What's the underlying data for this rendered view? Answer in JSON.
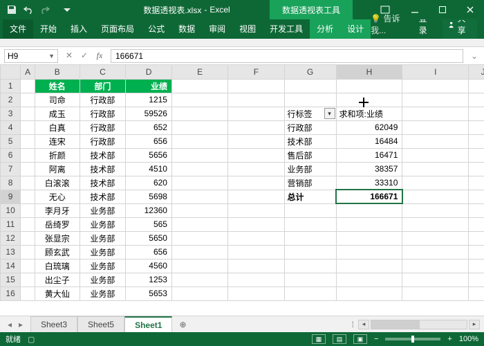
{
  "app": {
    "filename": "数据透视表.xlsx",
    "appname": "Excel",
    "context_tool": "数据透视表工具"
  },
  "ribbon": {
    "tabs": [
      "文件",
      "开始",
      "插入",
      "页面布局",
      "公式",
      "数据",
      "审阅",
      "视图",
      "开发工具",
      "分析",
      "设计"
    ],
    "tell_me": "告诉我...",
    "login": "登录",
    "share": "共享"
  },
  "namebox": {
    "ref": "H9",
    "formula": "166671"
  },
  "columns": [
    "",
    "A",
    "B",
    "C",
    "D",
    "E",
    "F",
    "G",
    "H",
    "I",
    "J"
  ],
  "data_rows": [
    {
      "r": "1",
      "b": "姓名",
      "c": "部门",
      "d": "业绩",
      "hdr": true
    },
    {
      "r": "2",
      "b": "司命",
      "c": "行政部",
      "d": "1215"
    },
    {
      "r": "3",
      "b": "成玉",
      "c": "行政部",
      "d": "59526",
      "g": "行标签",
      "h": "求和项:业绩",
      "pvt_hdr": true
    },
    {
      "r": "4",
      "b": "白真",
      "c": "行政部",
      "d": "652",
      "g": "行政部",
      "h": "62049"
    },
    {
      "r": "5",
      "b": "连宋",
      "c": "行政部",
      "d": "656",
      "g": "技术部",
      "h": "16484"
    },
    {
      "r": "6",
      "b": "折颜",
      "c": "技术部",
      "d": "5656",
      "g": "售后部",
      "h": "16471"
    },
    {
      "r": "7",
      "b": "阿离",
      "c": "技术部",
      "d": "4510",
      "g": "业务部",
      "h": "38357"
    },
    {
      "r": "8",
      "b": "白滚滚",
      "c": "技术部",
      "d": "620",
      "g": "营销部",
      "h": "33310"
    },
    {
      "r": "9",
      "b": "无心",
      "c": "技术部",
      "d": "5698",
      "g": "总计",
      "h": "166671",
      "total": true,
      "active": true
    },
    {
      "r": "10",
      "b": "李月牙",
      "c": "业务部",
      "d": "12360"
    },
    {
      "r": "11",
      "b": "岳绮罗",
      "c": "业务部",
      "d": "565"
    },
    {
      "r": "12",
      "b": "张显宗",
      "c": "业务部",
      "d": "5650"
    },
    {
      "r": "13",
      "b": "顾玄武",
      "c": "业务部",
      "d": "656"
    },
    {
      "r": "14",
      "b": "白琉璃",
      "c": "业务部",
      "d": "4560"
    },
    {
      "r": "15",
      "b": "出尘子",
      "c": "业务部",
      "d": "1253"
    },
    {
      "r": "16",
      "b": "黄大仙",
      "c": "业务部",
      "d": "5653"
    }
  ],
  "sheets": [
    "Sheet3",
    "Sheet5",
    "Sheet1"
  ],
  "active_sheet": "Sheet1",
  "status": {
    "ready": "就绪",
    "zoom": "100%"
  },
  "colwidths": {
    "rh": 28,
    "A": 20,
    "B": 62,
    "C": 64,
    "D": 64,
    "E": 78,
    "F": 78,
    "G": 72,
    "H": 92,
    "I": 92,
    "J": 40
  }
}
